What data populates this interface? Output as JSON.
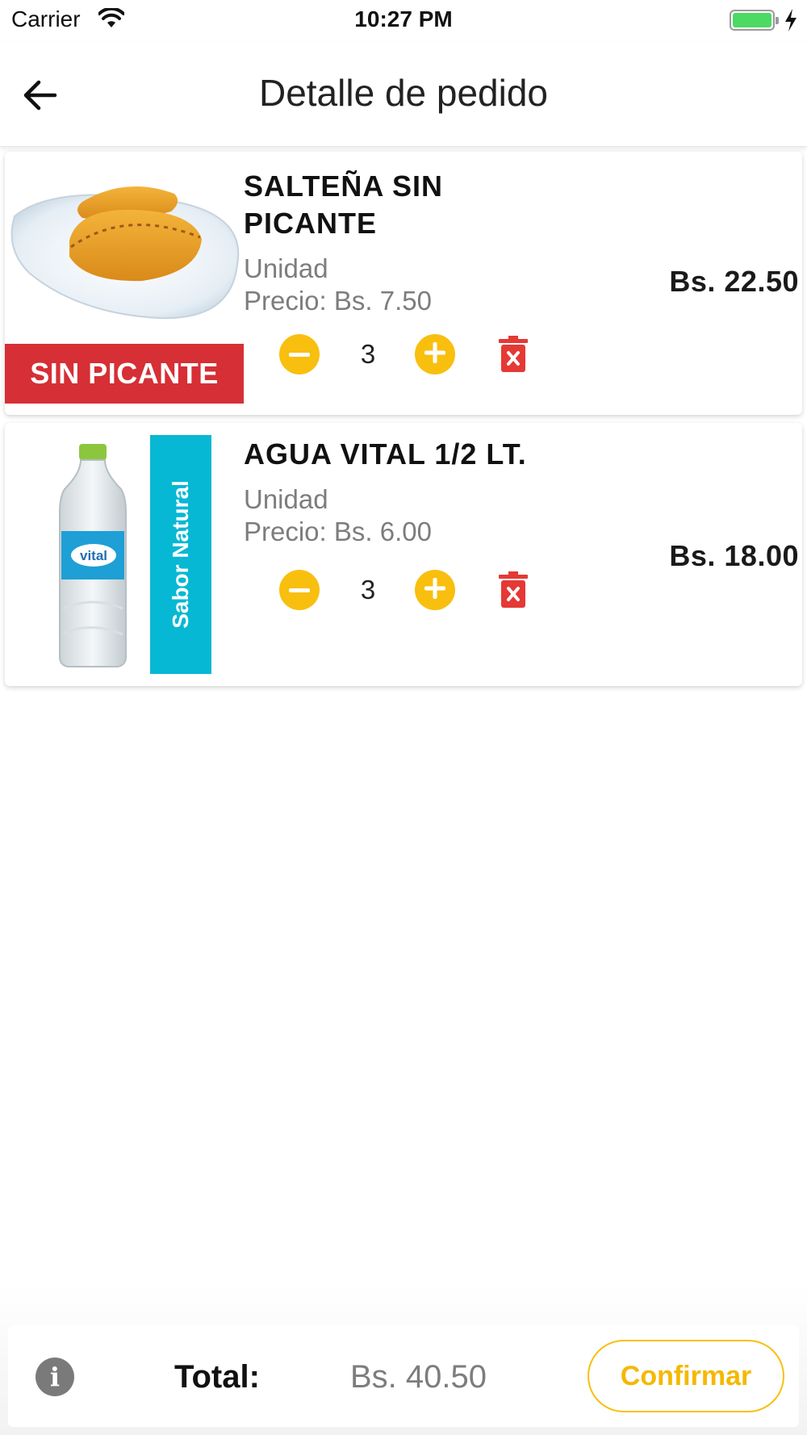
{
  "status_bar": {
    "carrier": "Carrier",
    "time": "10:27 PM",
    "battery_color": "#4cd964"
  },
  "header": {
    "title": "Detalle de pedido",
    "back_icon": "arrow-left-icon"
  },
  "items": [
    {
      "name": "SALTEÑA SIN PICANTE",
      "unit": "Unidad",
      "price": "Precio: Bs. 7.50",
      "quantity": "3",
      "line_total": "Bs. 22.50",
      "badge": "SIN PICANTE",
      "badge_color": "#d62f35",
      "image": "saltena-on-plate"
    },
    {
      "name": "AGUA VITAL  1/2 LT.",
      "unit": "Unidad",
      "price": "Precio: Bs. 6.00",
      "quantity": "3",
      "line_total": "Bs. 18.00",
      "badge": "Sabor Natural",
      "badge_color": "#06b8d4",
      "image": "water-bottle",
      "bottle_label": "vital"
    }
  ],
  "footer": {
    "total_label": "Total:",
    "total_value": "Bs. 40.50",
    "confirm_label": "Confirmar",
    "info_icon": "info-icon"
  },
  "colors": {
    "accent": "#f9bf0f",
    "delete": "#e53935"
  }
}
